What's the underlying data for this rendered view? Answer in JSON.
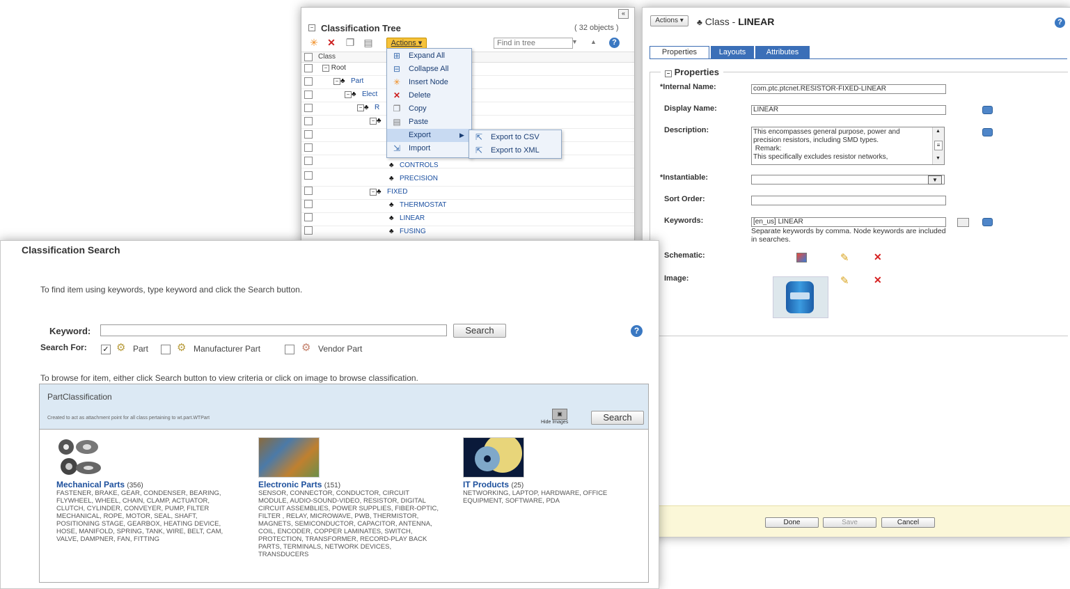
{
  "tree": {
    "title": "Classification Tree",
    "count": "( 32 objects )",
    "actions_label": "Actions ▾",
    "find_placeholder": "Find in tree",
    "column_header": "Class",
    "collapse_icon": "«",
    "nodes": [
      {
        "label": "Root"
      },
      {
        "label": "Part"
      },
      {
        "label": "Elect"
      },
      {
        "label": "R"
      },
      {
        "label": ""
      },
      {
        "label": ""
      },
      {
        "label": ""
      },
      {
        "label": ""
      },
      {
        "label": "CONTROLS"
      },
      {
        "label": "PRECISION"
      },
      {
        "label": "FIXED"
      },
      {
        "label": "THERMOSTAT"
      },
      {
        "label": "LINEAR"
      },
      {
        "label": "FUSING"
      }
    ]
  },
  "actions_menu": {
    "items": [
      {
        "label": "Expand All",
        "icon": "expand-all-icon"
      },
      {
        "label": "Collapse All",
        "icon": "collapse-all-icon"
      },
      {
        "label": "Insert Node",
        "icon": "insert-node-icon"
      },
      {
        "label": "Delete",
        "icon": "delete-icon"
      },
      {
        "label": "Copy",
        "icon": "copy-icon"
      },
      {
        "label": "Paste",
        "icon": "paste-icon"
      },
      {
        "label": "Export",
        "icon": "export-icon"
      },
      {
        "label": "Import",
        "icon": "import-icon"
      }
    ],
    "export_submenu": [
      {
        "label": "Export to CSV"
      },
      {
        "label": "Export to XML"
      }
    ]
  },
  "class_panel": {
    "actions_label": "Actions ▾",
    "title_prefix": "Class - ",
    "title_name": "LINEAR",
    "tabs": [
      "Properties",
      "Layouts",
      "Attributes"
    ],
    "section_title": "Properties",
    "fields": {
      "internal_name_label": "*Internal Name:",
      "internal_name_value": "com.ptc.ptcnet.RESISTOR-FIXED-LINEAR",
      "display_name_label": "Display Name:",
      "display_name_value": "LINEAR",
      "description_label": "Description:",
      "description_value": "This encompasses general purpose, power and precision resistors, including SMD types.\n Remark:\nThis specifically excludes resistor networks,",
      "instantiable_label": "*Instantiable:",
      "instantiable_value": "",
      "sort_order_label": "Sort Order:",
      "sort_order_value": "",
      "keywords_label": "Keywords:",
      "keywords_value": "[en_us] LINEAR",
      "keywords_hint": "Separate keywords by comma. Node keywords are included in searches.",
      "schematic_label": "Schematic:",
      "image_label": "Image:"
    },
    "buttons": {
      "done": "Done",
      "save": "Save",
      "cancel": "Cancel"
    }
  },
  "search_panel": {
    "title": "Classification Search",
    "intro": "To find item using keywords, type keyword and click the Search button.",
    "keyword_label": "Keyword:",
    "keyword_value": "",
    "search_button": "Search",
    "search_for_label": "Search For:",
    "options": [
      {
        "label": "Part",
        "checked": true
      },
      {
        "label": "Manufacturer Part",
        "checked": false
      },
      {
        "label": "Vendor Part",
        "checked": false
      }
    ],
    "browse_intro": "To browse for item, either click Search button to view criteria or click on image to browse classification.",
    "classification": {
      "title": "PartClassification",
      "description": "Created to act as attachment point for all class pertaining to wt.part.WTPart",
      "hide_images_label": "Hide Images",
      "search_button": "Search"
    },
    "categories": [
      {
        "name": "Mechanical Parts",
        "count": "(356)",
        "items": "FASTENER, BRAKE, GEAR, CONDENSER, BEARING, FLYWHEEL, WHEEL, CHAIN, CLAMP, ACTUATOR, CLUTCH, CYLINDER, CONVEYER, PUMP, FILTER MECHANICAL, ROPE, MOTOR, SEAL, SHAFT, POSITIONING STAGE, GEARBOX, HEATING DEVICE, HOSE, MANIFOLD, SPRING, TANK, WIRE, BELT, CAM, VALVE, DAMPNER, FAN, FITTING"
      },
      {
        "name": "Electronic Parts",
        "count": "(151)",
        "items": "SENSOR, CONNECTOR, CONDUCTOR, CIRCUIT MODULE, AUDIO-SOUND-VIDEO, RESISTOR, DIGITAL CIRCUIT ASSEMBLIES, POWER SUPPLIES, FIBER-OPTIC, FILTER , RELAY, MICROWAVE, PWB, THERMISTOR, MAGNETS, SEMICONDUCTOR, CAPACITOR, ANTENNA, COIL, ENCODER, COPPER LAMINATES, SWITCH, PROTECTION, TRANSFORMER, RECORD-PLAY BACK PARTS, TERMINALS, NETWORK DEVICES, TRANSDUCERS"
      },
      {
        "name": "IT Products",
        "count": "(25)",
        "items": "NETWORKING, LAPTOP, HARDWARE, OFFICE EQUIPMENT, SOFTWARE, PDA"
      }
    ]
  },
  "colors": {
    "accent": "#3b6fb8",
    "actions_button": "#f6c23a",
    "link": "#1c4f9c",
    "footer": "#fbf7d8"
  }
}
